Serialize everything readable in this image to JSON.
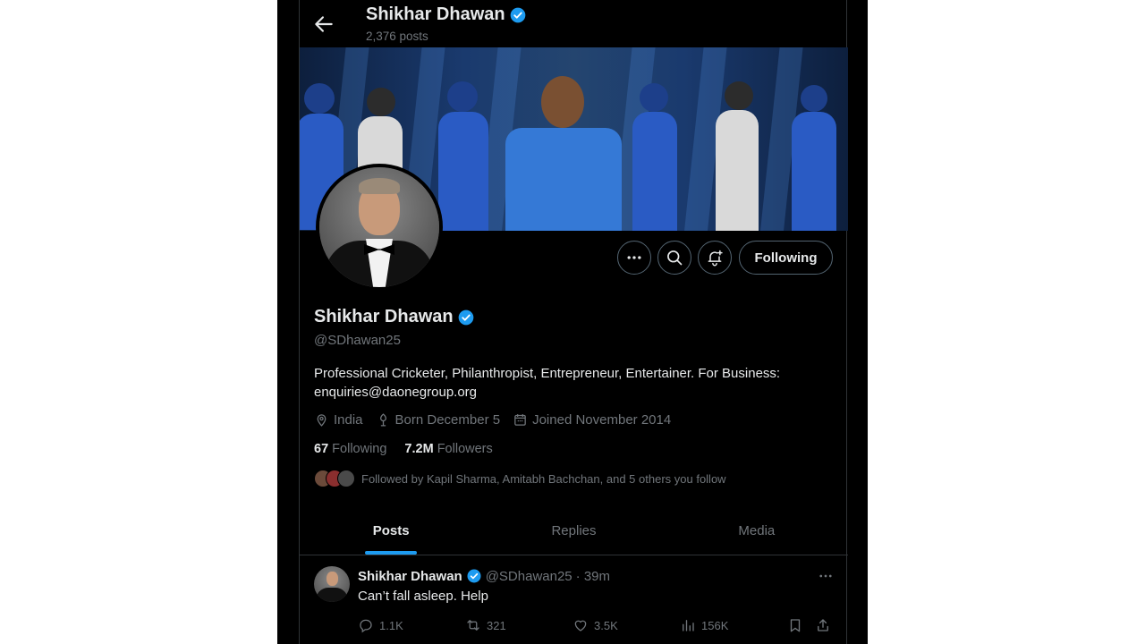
{
  "header": {
    "name": "Shikhar Dhawan",
    "posts_count": "2,376 posts"
  },
  "profile": {
    "name": "Shikhar Dhawan",
    "handle": "@SDhawan25",
    "bio": "Professional Cricketer, Philanthropist, Entrepreneur, Entertainer. For Business: enquiries@daonegroup.org",
    "location": "India",
    "birthday": "Born December 5",
    "joined": "Joined November 2014",
    "following_count": "67",
    "following_label": "Following",
    "followers_count": "7.2M",
    "followers_label": "Followers",
    "followed_by": "Followed by Kapil Sharma, Amitabh Bachchan, and 5 others you follow"
  },
  "actions": {
    "follow_state": "Following"
  },
  "tabs": [
    {
      "label": "Posts",
      "active": true
    },
    {
      "label": "Replies",
      "active": false
    },
    {
      "label": "Media",
      "active": false
    }
  ],
  "tweet": {
    "name": "Shikhar Dhawan",
    "handle": "@SDhawan25",
    "time": "· 39m",
    "text": "Can’t fall asleep. Help",
    "replies": "1.1K",
    "reposts": "321",
    "likes": "3.5K",
    "views": "156K"
  },
  "colors": {
    "background": "#000000",
    "accent": "#1d9bf0",
    "text": "#e7e9ea",
    "muted": "#71767b"
  },
  "icons": [
    "back-arrow-icon",
    "verified-badge-icon",
    "more-icon",
    "search-icon",
    "notification-bell-icon",
    "location-icon",
    "birthday-icon",
    "calendar-icon",
    "reply-icon",
    "repost-icon",
    "like-icon",
    "views-icon",
    "bookmark-icon",
    "share-icon"
  ]
}
